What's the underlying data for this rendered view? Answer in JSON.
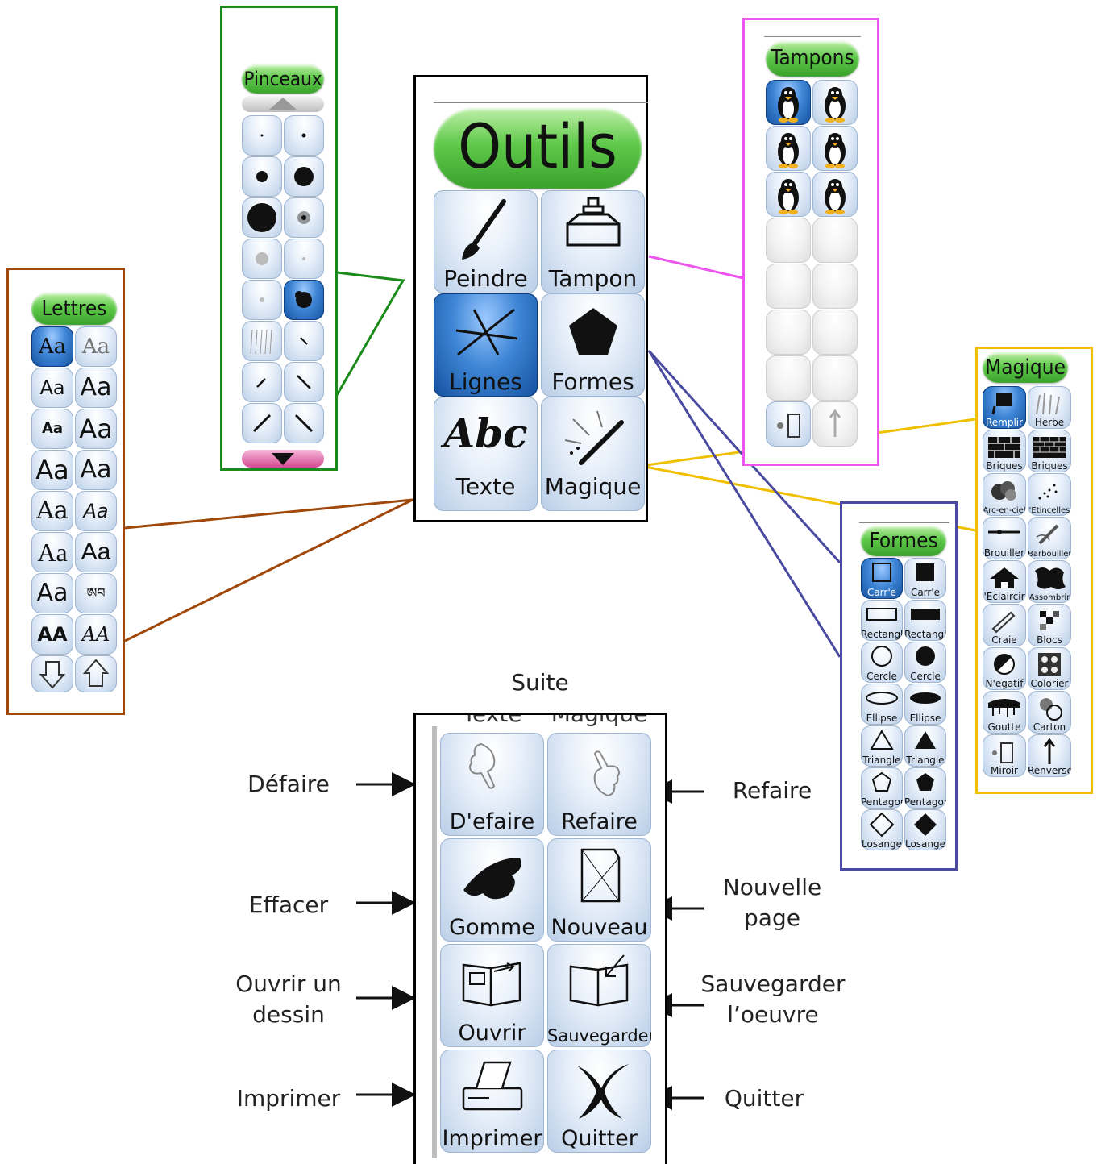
{
  "center": {
    "title": "Outils",
    "tools": [
      "Peindre",
      "Tampon",
      "Lignes",
      "Formes",
      "Texte",
      "Magique"
    ]
  },
  "pinceaux": {
    "title": "Pinceaux"
  },
  "tampons": {
    "title": "Tampons"
  },
  "lettres": {
    "title": "Lettres"
  },
  "magique": {
    "title": "Magique",
    "items": [
      "Remplir",
      "Herbe",
      "Briques",
      "Briques",
      "Arc-en-ciel",
      "'Etincelles",
      "Brouiller",
      "Barbouiller",
      "'Eclaircir",
      "Assombrir",
      "Craie",
      "Blocs",
      "N'egatif",
      "Colorier",
      "Goutte",
      "Carton",
      "Miroir",
      "Renverser"
    ]
  },
  "formes": {
    "title": "Formes",
    "items": [
      "Carr'e",
      "Carr'e",
      "Rectangle",
      "Rectangle",
      "Cercle",
      "Cercle",
      "Ellipse",
      "Ellipse",
      "Triangle",
      "Triangle",
      "Pentagone",
      "Pentagone",
      "Losange",
      "Losange"
    ]
  },
  "suite": {
    "caption": "Suite",
    "buttons": [
      "D'efaire",
      "Refaire",
      "Gomme",
      "Nouveau",
      "Ouvrir",
      "Sauvegarder",
      "Imprimer",
      "Quitter"
    ],
    "partial_labels": [
      "Texte",
      "Magique"
    ]
  },
  "annotations": {
    "defaire": "Défaire",
    "refaire": "Refaire",
    "effacer": "Effacer",
    "nouvelle_page": "Nouvelle page",
    "ouvrir": "Ouvrir un dessin",
    "sauvegarder": "Sauvegarder l’oeuvre",
    "imprimer": "Imprimer",
    "quitter": "Quitter"
  },
  "colors": {
    "outils_frame": "#000000",
    "pinceaux_frame": "#1a8a1a",
    "tampons_frame": "#ee55ee",
    "lettres_frame": "#a0480a",
    "magique_frame": "#f0c000",
    "formes_frame": "#4a4aa0",
    "pill_green": "#4cb83a",
    "button_selected": "#2a6fc0"
  }
}
